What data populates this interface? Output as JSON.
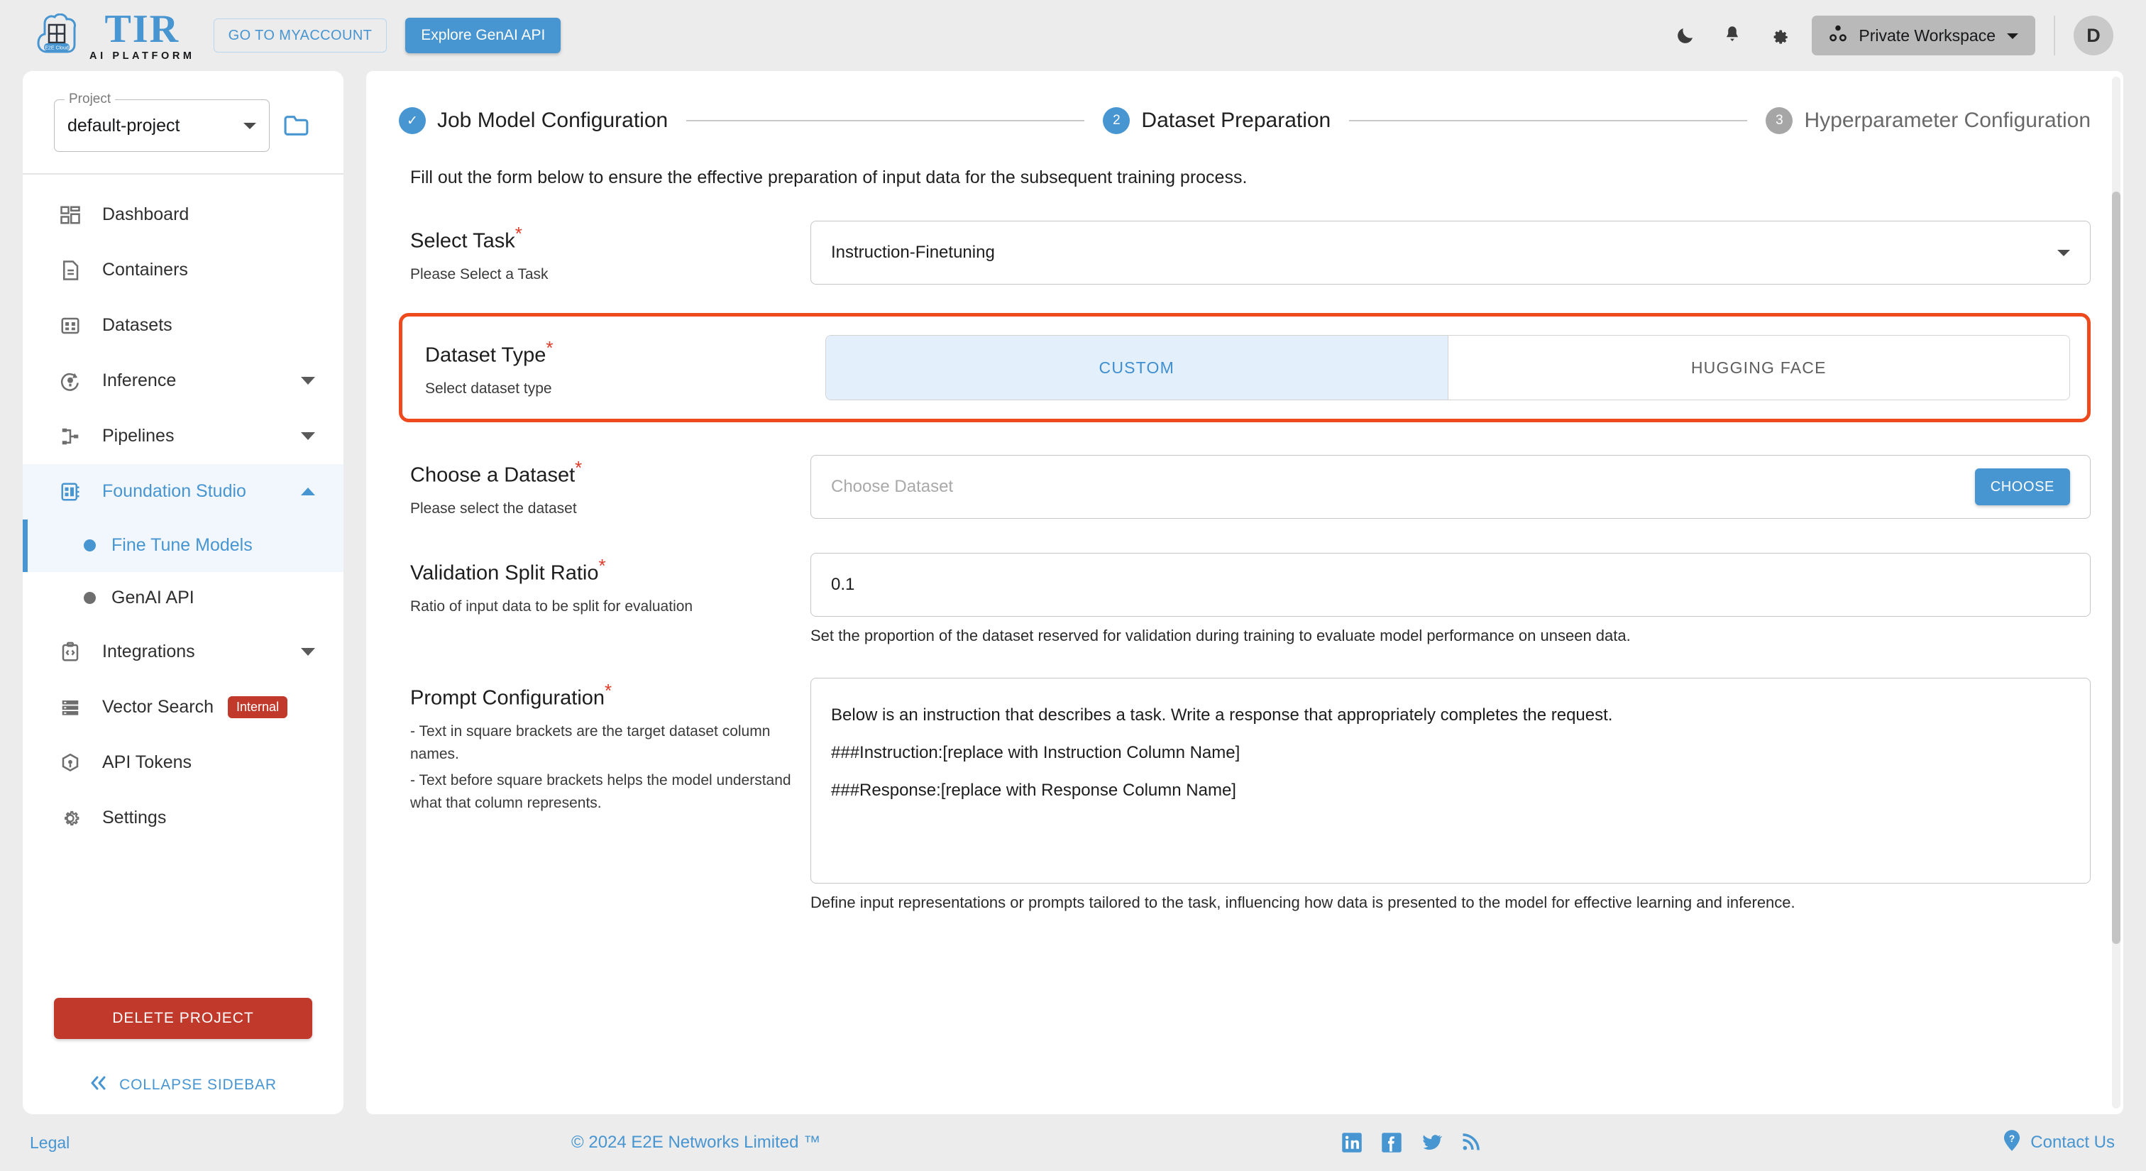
{
  "topbar": {
    "logo_title": "TIR",
    "logo_subtitle": "AI PLATFORM",
    "logo_cloud_text": "E2E Cloud",
    "myaccount_label": "GO TO MYACCOUNT",
    "genai_label": "Explore GenAI API",
    "workspace_label": "Private Workspace",
    "avatar_initial": "D",
    "icons": [
      "dark-mode-icon",
      "notification-bell-icon",
      "settings-gear-icon",
      "workspace-icon",
      "chevron-down-icon"
    ]
  },
  "sidebar": {
    "project_legend": "Project",
    "project_value": "default-project",
    "new_folder_icon": "new-folder-icon",
    "items": [
      {
        "label": "Dashboard",
        "icon": "dashboard-icon",
        "expandable": false,
        "active": false
      },
      {
        "label": "Containers",
        "icon": "document-icon",
        "expandable": false,
        "active": false
      },
      {
        "label": "Datasets",
        "icon": "grid-table-icon",
        "expandable": false,
        "active": false
      },
      {
        "label": "Inference",
        "icon": "inference-icon",
        "expandable": true,
        "active": false
      },
      {
        "label": "Pipelines",
        "icon": "pipelines-icon",
        "expandable": true,
        "active": false
      },
      {
        "label": "Foundation Studio",
        "icon": "foundation-studio-icon",
        "expandable": true,
        "active": true
      }
    ],
    "sub_items": [
      {
        "label": "Fine Tune Models",
        "active": true
      },
      {
        "label": "GenAI API",
        "active": false
      }
    ],
    "items_after": [
      {
        "label": "Integrations",
        "icon": "code-brackets-icon",
        "expandable": true,
        "badge": ""
      },
      {
        "label": "Vector Search",
        "icon": "server-stack-icon",
        "expandable": false,
        "badge": "Internal"
      },
      {
        "label": "API Tokens",
        "icon": "cube-token-icon",
        "expandable": false,
        "badge": ""
      },
      {
        "label": "Settings",
        "icon": "settings-gear-icon",
        "expandable": false,
        "badge": ""
      }
    ],
    "delete_label": "DELETE PROJECT",
    "collapse_label": "COLLAPSE SIDEBAR",
    "collapse_icon": "double-chevron-left-icon"
  },
  "stepper": {
    "steps": [
      {
        "badge": "✓",
        "label": "Job Model Configuration",
        "state": "done"
      },
      {
        "badge": "2",
        "label": "Dataset Preparation",
        "state": "active"
      },
      {
        "badge": "3",
        "label": "Hyperparameter Configuration",
        "state": "idle"
      }
    ]
  },
  "main": {
    "intro": "Fill out the form below to ensure the effective preparation of input data for the subsequent training process.",
    "select_task": {
      "title": "Select Task",
      "required_mark": "*",
      "subtitle": "Please Select a Task",
      "value": "Instruction-Finetuning"
    },
    "dataset_type": {
      "title": "Dataset Type",
      "required_mark": "*",
      "subtitle": "Select dataset type",
      "options": [
        "CUSTOM",
        "HUGGING FACE"
      ],
      "selected": "CUSTOM",
      "highlight_color": "#ef4a1e"
    },
    "choose_dataset": {
      "title": "Choose a Dataset",
      "required_mark": "*",
      "subtitle": "Please select the dataset",
      "placeholder": "Choose Dataset",
      "button_label": "CHOOSE"
    },
    "validation_split": {
      "title": "Validation Split Ratio",
      "required_mark": "*",
      "subtitle": "Ratio of input data to be split for evaluation",
      "value": "0.1",
      "helper": "Set the proportion of the dataset reserved for validation during training to evaluate model performance on unseen data."
    },
    "prompt_config": {
      "title": "Prompt Configuration",
      "required_mark": "*",
      "subtitle_line1": "- Text in square brackets are the target dataset column names.",
      "subtitle_line2": "- Text before square brackets helps the model understand what that column represents.",
      "value_line1": "Below is an instruction that describes a task. Write a response that appropriately completes the request.",
      "value_line2": "###Instruction:[replace with Instruction Column Name]",
      "value_line3": "###Response:[replace with Response Column Name]",
      "helper": "Define input representations or prompts tailored to the task, influencing how data is presented to the model for effective learning and inference."
    }
  },
  "footer": {
    "legal": "Legal",
    "copyright": "© 2024 E2E Networks Limited ™",
    "social": [
      "linkedin-icon",
      "facebook-icon",
      "twitter-icon",
      "rss-icon"
    ],
    "contact": "Contact Us",
    "contact_icon": "help-question-icon"
  },
  "colors": {
    "accent": "#4795d1",
    "danger": "#c0392b",
    "highlight": "#ef4a1e"
  }
}
